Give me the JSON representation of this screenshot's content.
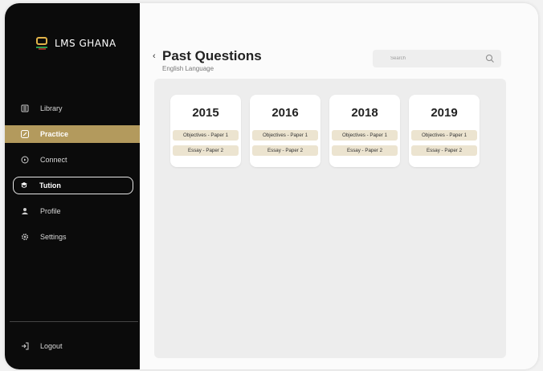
{
  "app": {
    "logo_text": "LMS GHANA"
  },
  "sidebar": {
    "items": [
      {
        "label": "Library",
        "icon": "library-icon"
      },
      {
        "label": "Practice",
        "icon": "practice-icon",
        "state": "active"
      },
      {
        "label": "Connect",
        "icon": "connect-icon"
      },
      {
        "label": "Tution",
        "icon": "tution-icon",
        "state": "outlined"
      },
      {
        "label": "Profile",
        "icon": "profile-icon"
      },
      {
        "label": "Settings",
        "icon": "settings-icon"
      }
    ],
    "logout_label": "Logout"
  },
  "page": {
    "title": "Past Questions",
    "subtitle": "English Language",
    "search_placeholder": "Search"
  },
  "cards": [
    {
      "year": "2015",
      "paper1": "Objectives - Paper 1",
      "paper2": "Essay - Paper 2"
    },
    {
      "year": "2016",
      "paper1": "Objectives - Paper 1",
      "paper2": "Essay - Paper 2"
    },
    {
      "year": "2018",
      "paper1": "Objectives - Paper 1",
      "paper2": "Essay - Paper 2"
    },
    {
      "year": "2019",
      "paper1": "Objectives - Paper 1",
      "paper2": "Essay - Paper 2"
    }
  ],
  "colors": {
    "accent": "#b39a5d",
    "sidebar_bg": "#0b0b0b",
    "pill_bg": "#ece4d0"
  }
}
